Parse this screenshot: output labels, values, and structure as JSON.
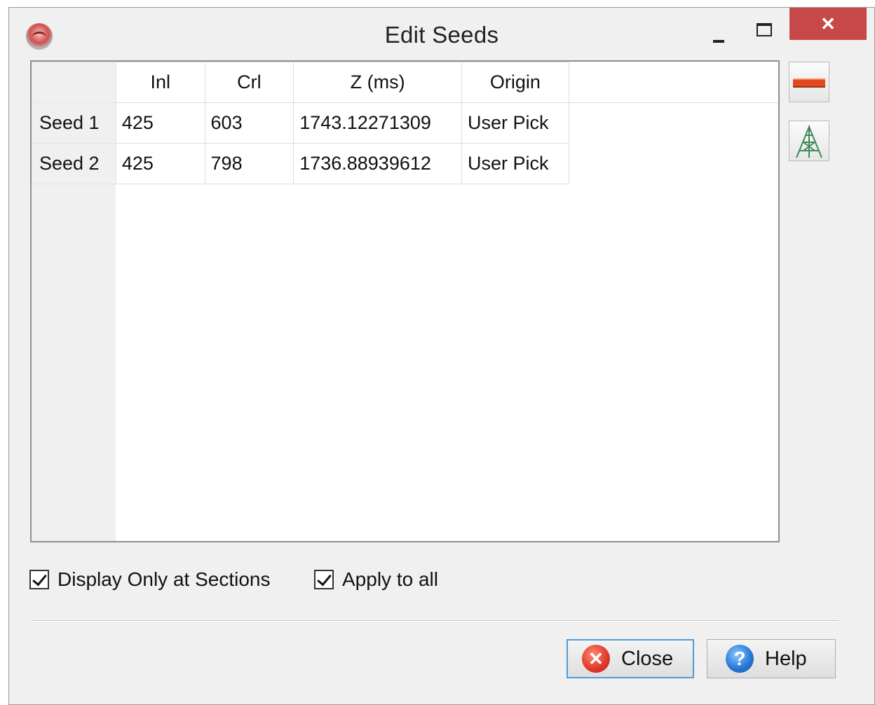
{
  "window": {
    "title": "Edit Seeds"
  },
  "titlebar": {
    "close_glyph": "✕"
  },
  "table": {
    "columns": [
      "Inl",
      "Crl",
      "Z (ms)",
      "Origin"
    ],
    "rows": [
      {
        "header": "Seed 1",
        "inl": "425",
        "crl": "603",
        "z": "1743.12271309",
        "origin": "User Pick"
      },
      {
        "header": "Seed 2",
        "inl": "425",
        "crl": "798",
        "z": "1736.88939612",
        "origin": "User Pick"
      }
    ]
  },
  "side_buttons": {
    "remove_icon": "remove-seed-icon",
    "tracker_icon": "tracker-settings-icon"
  },
  "options": {
    "display_only_at_sections": {
      "label": "Display Only at Sections",
      "checked": true
    },
    "apply_to_all": {
      "label": "Apply to all",
      "checked": true
    }
  },
  "buttons": {
    "close": {
      "label": "Close",
      "icon": "close-circle-icon",
      "glyph": "✕"
    },
    "help": {
      "label": "Help",
      "icon": "help-icon",
      "glyph": "?"
    }
  },
  "colors": {
    "close_button_accent": "#c74848",
    "focus_border": "#4d9ed8",
    "remove_bar": "#e0491e"
  }
}
